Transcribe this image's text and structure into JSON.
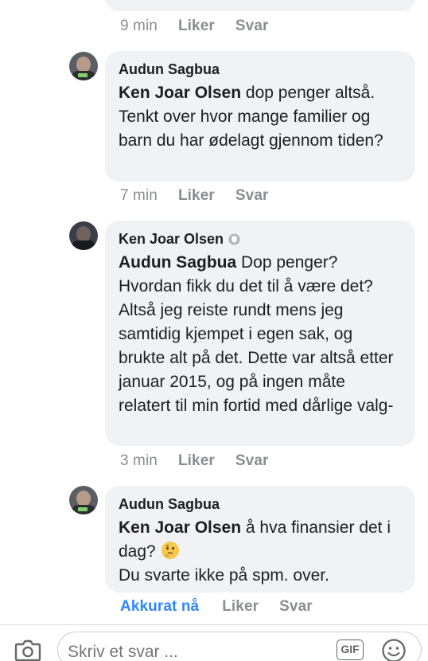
{
  "thread": {
    "prev_actions": {
      "time": "9 min",
      "like": "Liker",
      "reply": "Svar"
    },
    "comments": [
      {
        "author": "Audun Sagbua",
        "mention": "Ken Joar Olsen",
        "text": " dop penger altså. Tenkt over hvor mange familier og barn du har ødelagt gjennom tiden?",
        "time": "7 min",
        "like": "Liker",
        "reply": "Svar"
      },
      {
        "author": "Ken Joar Olsen",
        "author_badge_icon": "shield-icon",
        "mention": "Audun Sagbua",
        "text": " Dop penger? Hvordan fikk du det til å være det? Altså jeg reiste rundt mens jeg samtidig kjempet i egen sak, og brukte alt på det. Dette var altså etter januar 2015, og på ingen måte relatert til min fortid med dårlige valg-",
        "time": "3 min",
        "like": "Liker",
        "reply": "Svar"
      },
      {
        "author": "Audun Sagbua",
        "mention": "Ken Joar Olsen",
        "text_line1": " å hva finansier det i dag?",
        "emoji": "thinking-face",
        "text_line2": "Du svarte ikke på spm. over.",
        "time": "Akkurat nå",
        "like": "Liker",
        "reply": "Svar"
      }
    ]
  },
  "composer": {
    "placeholder": "Skriv et svar ...",
    "gif_label": "GIF",
    "camera_icon": "camera-icon",
    "emoji_icon": "smiley-icon"
  },
  "colors": {
    "bubble": "#f0f2f5",
    "meta_gray": "#8a8d91",
    "accent_blue": "#2d88ff",
    "text": "#1c1e21"
  }
}
